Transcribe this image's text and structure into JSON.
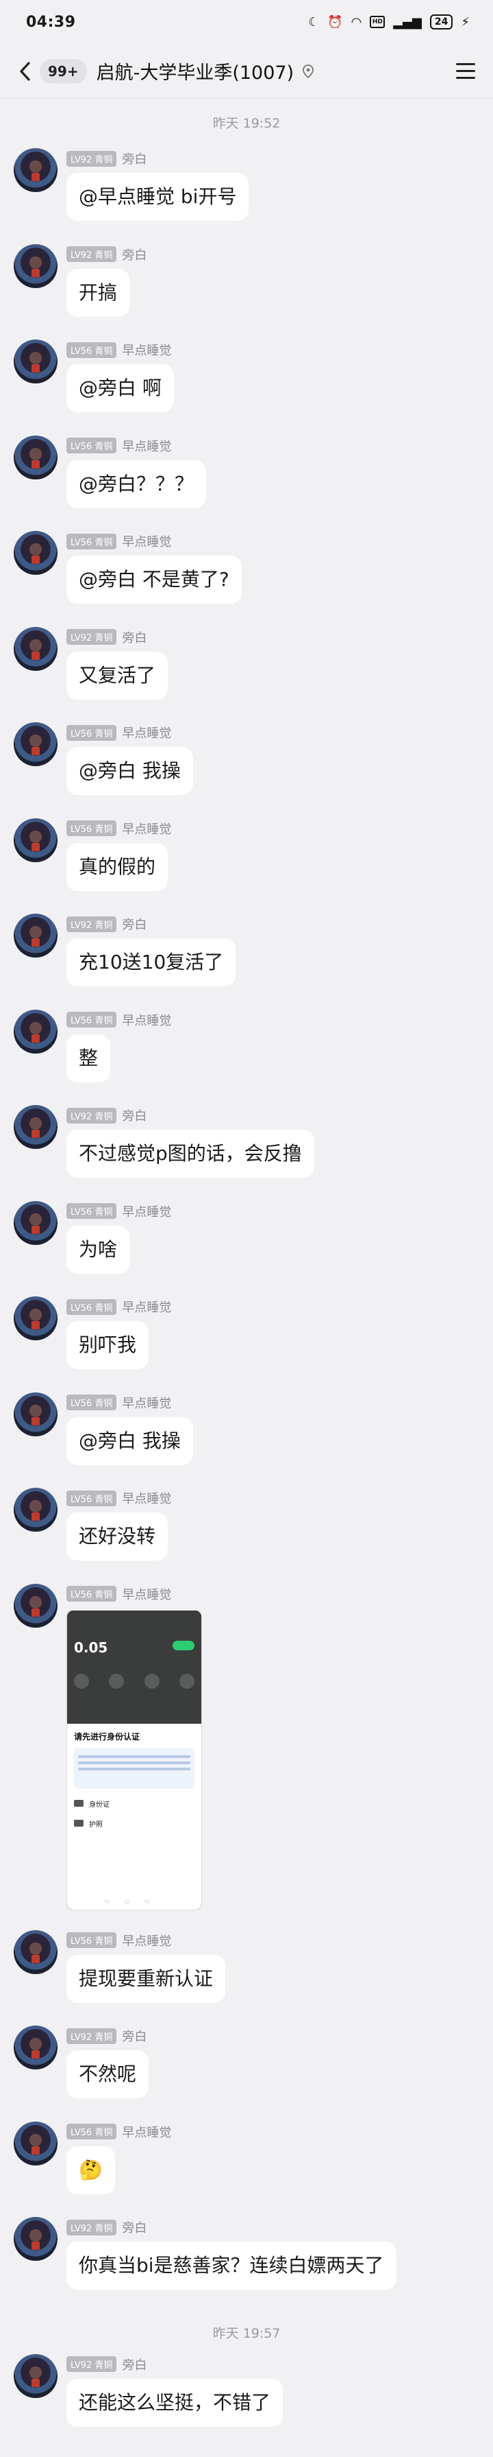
{
  "status_bar": {
    "time": "04:39",
    "icons": [
      "moon-icon",
      "alarm-icon",
      "wifi-icon",
      "hd-icon",
      "signal-icon"
    ],
    "battery": "24"
  },
  "header": {
    "back_badge": "99+",
    "title": "启航-大学毕业季(1007)"
  },
  "dividers": [
    "昨天 19:52",
    "昨天 19:57"
  ],
  "messages": [
    {
      "level": "LV92 青铜",
      "sender": "旁白",
      "text": "@早点睡觉 bi开号"
    },
    {
      "level": "LV92 青铜",
      "sender": "旁白",
      "text": "开搞"
    },
    {
      "level": "LV56 青铜",
      "sender": "早点睡觉",
      "text": "@旁白 啊"
    },
    {
      "level": "LV56 青铜",
      "sender": "早点睡觉",
      "text": "@旁白？？？"
    },
    {
      "level": "LV56 青铜",
      "sender": "早点睡觉",
      "text": "@旁白 不是黄了?"
    },
    {
      "level": "LV92 青铜",
      "sender": "旁白",
      "text": "又复活了"
    },
    {
      "level": "LV56 青铜",
      "sender": "早点睡觉",
      "text": "@旁白 我操"
    },
    {
      "level": "LV56 青铜",
      "sender": "早点睡觉",
      "text": "真的假的"
    },
    {
      "level": "LV92 青铜",
      "sender": "旁白",
      "text": "充10送10复活了"
    },
    {
      "level": "LV56 青铜",
      "sender": "早点睡觉",
      "text": "整"
    },
    {
      "level": "LV92 青铜",
      "sender": "旁白",
      "text": "不过感觉p图的话，会反撸"
    },
    {
      "level": "LV56 青铜",
      "sender": "早点睡觉",
      "text": "为啥"
    },
    {
      "level": "LV56 青铜",
      "sender": "早点睡觉",
      "text": "别吓我"
    },
    {
      "level": "LV56 青铜",
      "sender": "早点睡觉",
      "text": "@旁白 我操"
    },
    {
      "level": "LV56 青铜",
      "sender": "早点睡觉",
      "text": "还好没转"
    }
  ],
  "image_message": {
    "level": "LV56 青铜",
    "sender": "早点睡觉",
    "screenshot": {
      "amount": "0.05",
      "sheet_title": "请先进行身份认证",
      "option_1": "身份证",
      "option_2": "护照"
    }
  },
  "messages_after": [
    {
      "level": "LV56 青铜",
      "sender": "早点睡觉",
      "text": "提现要重新认证"
    },
    {
      "level": "LV92 青铜",
      "sender": "旁白",
      "text": "不然呢"
    },
    {
      "level": "LV56 青铜",
      "sender": "早点睡觉",
      "text": "🤔"
    },
    {
      "level": "LV92 青铜",
      "sender": "旁白",
      "text": "你真当bi是慈善家？连续白嫖两天了"
    }
  ],
  "messages_last": [
    {
      "level": "LV92 青铜",
      "sender": "旁白",
      "text": "还能这么坚挺，不错了"
    }
  ]
}
